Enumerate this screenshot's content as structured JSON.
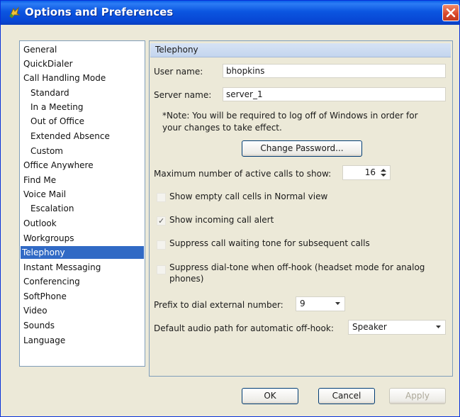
{
  "window": {
    "title": "Options and Preferences",
    "title_icon": "app-icon",
    "close_icon": "close-icon",
    "colors": {
      "titlebar": "#0b55e0",
      "selection": "#316ac5",
      "close": "#d9462a"
    }
  },
  "nav": {
    "items": [
      {
        "label": "General",
        "indent": 0,
        "selected": false
      },
      {
        "label": "QuickDialer",
        "indent": 0,
        "selected": false
      },
      {
        "label": "Call Handling Mode",
        "indent": 0,
        "selected": false
      },
      {
        "label": "Standard",
        "indent": 1,
        "selected": false
      },
      {
        "label": "In a Meeting",
        "indent": 1,
        "selected": false
      },
      {
        "label": "Out of Office",
        "indent": 1,
        "selected": false
      },
      {
        "label": "Extended Absence",
        "indent": 1,
        "selected": false
      },
      {
        "label": "Custom",
        "indent": 1,
        "selected": false
      },
      {
        "label": "Office Anywhere",
        "indent": 0,
        "selected": false
      },
      {
        "label": "Find Me",
        "indent": 0,
        "selected": false
      },
      {
        "label": "Voice Mail",
        "indent": 0,
        "selected": false
      },
      {
        "label": "Escalation",
        "indent": 1,
        "selected": false
      },
      {
        "label": "Outlook",
        "indent": 0,
        "selected": false
      },
      {
        "label": "Workgroups",
        "indent": 0,
        "selected": false
      },
      {
        "label": "Telephony",
        "indent": 0,
        "selected": true
      },
      {
        "label": "Instant Messaging",
        "indent": 0,
        "selected": false
      },
      {
        "label": "Conferencing",
        "indent": 0,
        "selected": false
      },
      {
        "label": "SoftPhone",
        "indent": 0,
        "selected": false
      },
      {
        "label": "Video",
        "indent": 0,
        "selected": false
      },
      {
        "label": "Sounds",
        "indent": 0,
        "selected": false
      },
      {
        "label": "Language",
        "indent": 0,
        "selected": false
      }
    ]
  },
  "panel": {
    "header": "Telephony",
    "user_name_label": "User name:",
    "user_name_value": "bhopkins",
    "server_name_label": "Server name:",
    "server_name_value": "server_1",
    "note_line1": "*Note: You will be required to log off of Windows in order for",
    "note_line2": "your changes to take effect.",
    "change_password_label": "Change Password...",
    "max_calls_label": "Maximum number of active calls to show:",
    "max_calls_value": "16",
    "show_empty_label": "Show empty call cells in Normal view",
    "show_empty_checked": false,
    "show_incoming_label": "Show incoming call alert",
    "show_incoming_checked": true,
    "suppress_waiting_label": "Suppress call waiting tone for subsequent calls",
    "suppress_waiting_checked": false,
    "suppress_dialtone_line1": "Suppress dial-tone when off-hook (headset mode for analog",
    "suppress_dialtone_line2": "phones)",
    "suppress_dialtone_checked": false,
    "prefix_label": "Prefix to dial external number:",
    "prefix_value": "9",
    "audio_path_label": "Default audio path for automatic off-hook:",
    "audio_path_value": "Speaker"
  },
  "footer": {
    "ok_label": "OK",
    "cancel_label": "Cancel",
    "apply_label": "Apply"
  }
}
